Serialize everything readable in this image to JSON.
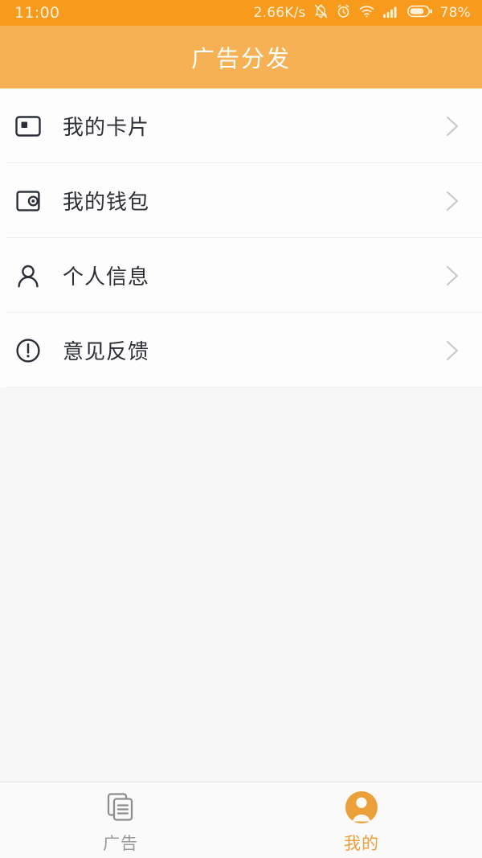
{
  "status_bar": {
    "time": "11:00",
    "network_speed": "2.66K/s",
    "battery_percent": "78%",
    "icons": [
      "mute-bell-icon",
      "alarm-clock-icon",
      "wifi-icon",
      "signal-bars-icon",
      "battery-icon"
    ],
    "background_color": "#F89A1C",
    "text_color": "#FDF2DC"
  },
  "header": {
    "title": "广告分发",
    "background_color": "#F5B153",
    "title_color": "#FFFFFF"
  },
  "list": {
    "items": [
      {
        "label": "我的卡片",
        "icon": "card-icon",
        "chevron": "chevron-right-icon"
      },
      {
        "label": "我的钱包",
        "icon": "wallet-icon",
        "chevron": "chevron-right-icon"
      },
      {
        "label": "个人信息",
        "icon": "person-icon",
        "chevron": "chevron-right-icon"
      },
      {
        "label": "意见反馈",
        "icon": "exclamation-circle-icon",
        "chevron": "chevron-right-icon"
      }
    ],
    "row_background": "#FDFDFD",
    "divider_color": "#EDEDEE",
    "label_color": "#2C2F36"
  },
  "content": {
    "background_color": "#F7F7F7"
  },
  "tab_bar": {
    "tabs": [
      {
        "label": "广告",
        "icon": "documents-icon",
        "active": false,
        "color": "#9A9A9A"
      },
      {
        "label": "我的",
        "icon": "user-avatar-icon",
        "active": true,
        "color": "#ECA03A"
      }
    ],
    "background_color": "#FAFAFA",
    "accent_color": "#ECA03A"
  }
}
